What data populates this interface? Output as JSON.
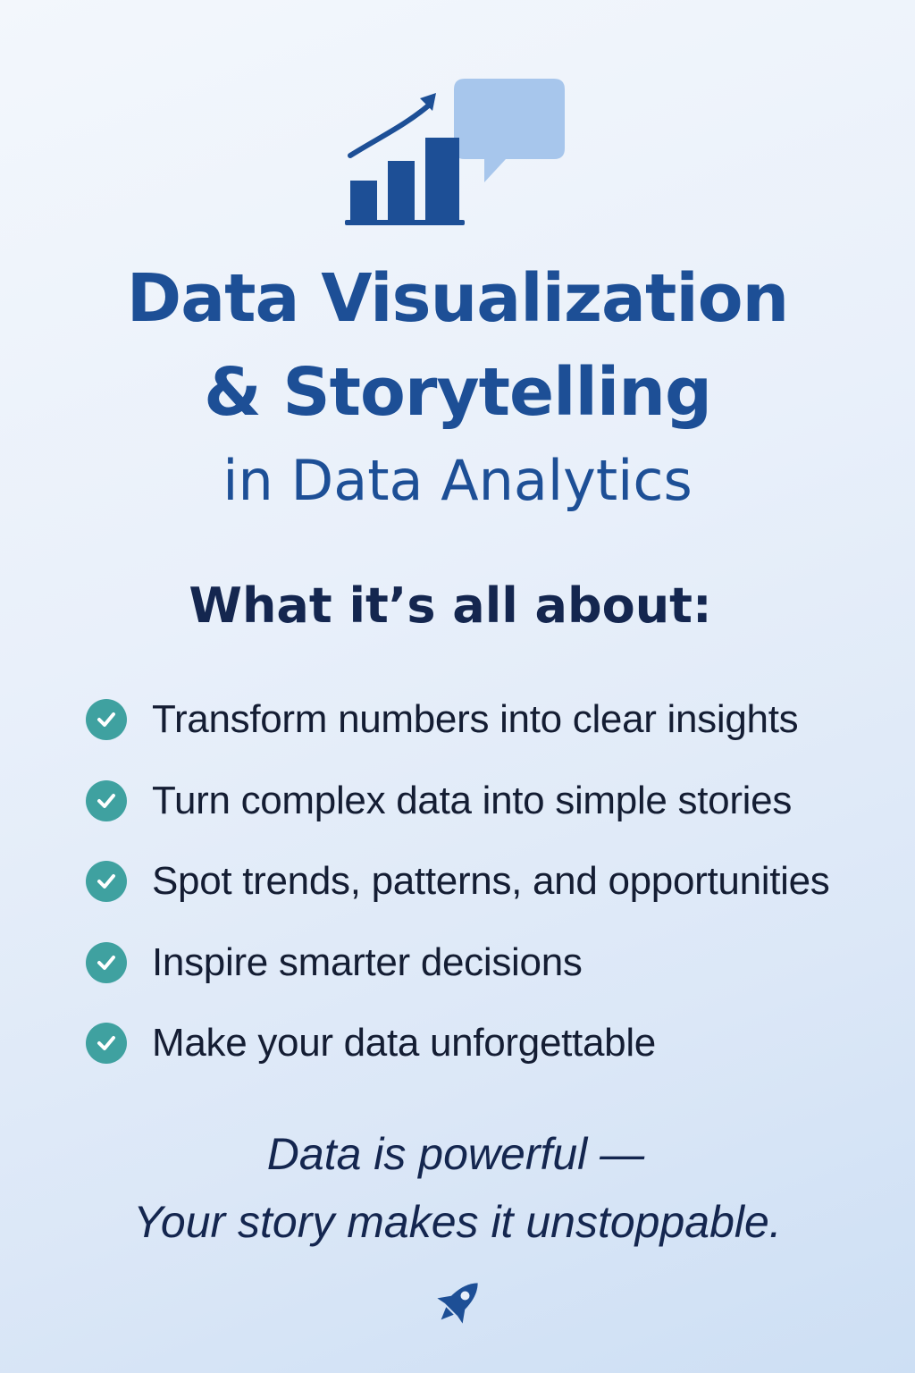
{
  "header": {
    "icon": "bar-chart-growth-with-speech-bubble-icon",
    "title_line1": "Data Visualization",
    "title_line2": "& Storytelling",
    "subtitle": "in Data Analytics"
  },
  "section": {
    "heading": "What it’s all about:",
    "check_icon": "check-circle-icon",
    "items": [
      {
        "label": "Transform numbers into clear insights"
      },
      {
        "label": "Turn complex data into simple stories"
      },
      {
        "label": "Spot trends, patterns, and opportunities"
      },
      {
        "label": "Inspire smarter decisions"
      },
      {
        "label": "Make your data unforgettable"
      }
    ]
  },
  "footer": {
    "quote_line1": "Data is powerful —",
    "quote_line2": "Your story makes it unstoppable.",
    "icon": "rocket-icon"
  },
  "colors": {
    "title": "#1d4f96",
    "heading": "#14264f",
    "accent_check": "#3fa1a0",
    "bubble": "#a7c6ec"
  }
}
